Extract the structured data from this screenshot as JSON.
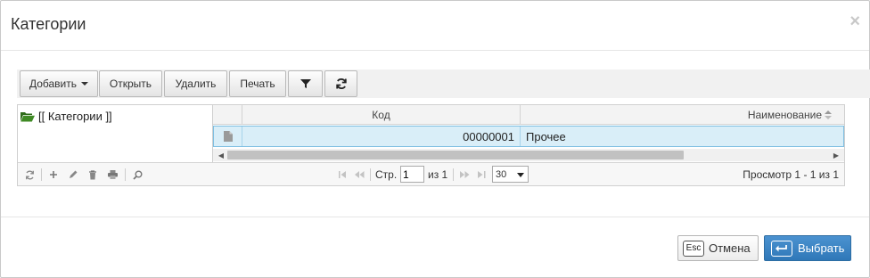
{
  "dialog": {
    "title": "Категории",
    "close_glyph": "×"
  },
  "toolbar": {
    "add_label": "Добавить",
    "open_label": "Открыть",
    "delete_label": "Удалить",
    "print_label": "Печать",
    "filter_icon": "filter-icon",
    "refresh_icon": "refresh-icon"
  },
  "tree": {
    "root_label": "[[ Категории ]]",
    "root_icon": "folder-open-icon",
    "folder_color": "#2e6b1a"
  },
  "grid": {
    "columns": [
      {
        "label": "Код"
      },
      {
        "label": "Наименование",
        "sort_icon": "sort-icon"
      }
    ],
    "rows": [
      {
        "code": "00000001",
        "name": "Прочее",
        "icon": "document-icon"
      }
    ],
    "selected_row_color": "#d9eef8"
  },
  "pager": {
    "icons": [
      "refresh-icon",
      "plus-icon",
      "pencil-icon",
      "trash-icon",
      "print-icon",
      "search-icon"
    ],
    "page_label": "Стр.",
    "page_value": "1",
    "of_label": "из 1",
    "page_size": "30",
    "view_text": "Просмотр 1 - 1 из 1"
  },
  "footer": {
    "cancel_key": "Esc",
    "cancel_label": "Отмена",
    "select_label": "Выбрать",
    "select_color": "#337ab7"
  }
}
